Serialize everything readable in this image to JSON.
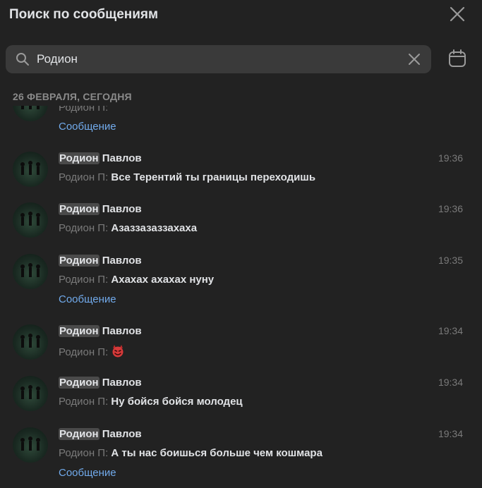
{
  "header": {
    "title": "Поиск по сообщениям"
  },
  "search": {
    "value": "Родион"
  },
  "date_label": "26 ФЕВРАЛЯ, СЕГОДНЯ",
  "partial": {
    "sender": "Родион П:",
    "link": "Сообщение"
  },
  "results": [
    {
      "name_highlight": "Родион",
      "name_rest": " Павлов",
      "time": "19:36",
      "sender": "Родион П:",
      "text": "Все Терентий ты границы переходишь",
      "link": ""
    },
    {
      "name_highlight": "Родион",
      "name_rest": " Павлов",
      "time": "19:36",
      "sender": "Родион П:",
      "text": "Азаззазаззахаха",
      "link": ""
    },
    {
      "name_highlight": "Родион",
      "name_rest": " Павлов",
      "time": "19:35",
      "sender": "Родион П:",
      "text": "Ахахах ахахах нуну",
      "link": "Сообщение"
    },
    {
      "name_highlight": "Родион",
      "name_rest": " Павлов",
      "time": "19:34",
      "sender": "Родион П:",
      "text": "",
      "emoji": "smiling-devil-emoji",
      "link": ""
    },
    {
      "name_highlight": "Родион",
      "name_rest": " Павлов",
      "time": "19:34",
      "sender": "Родион П:",
      "text": "Ну бойся бойся молодец",
      "link": ""
    },
    {
      "name_highlight": "Родион",
      "name_rest": " Павлов",
      "time": "19:34",
      "sender": "Родион П:",
      "text": "А ты нас боишься больше чем кошмара",
      "link": "Сообщение"
    }
  ],
  "colors": {
    "background": "#222222",
    "link": "#71aaeb",
    "muted": "#7a7a7a",
    "search_bg": "#3a3a3a"
  }
}
